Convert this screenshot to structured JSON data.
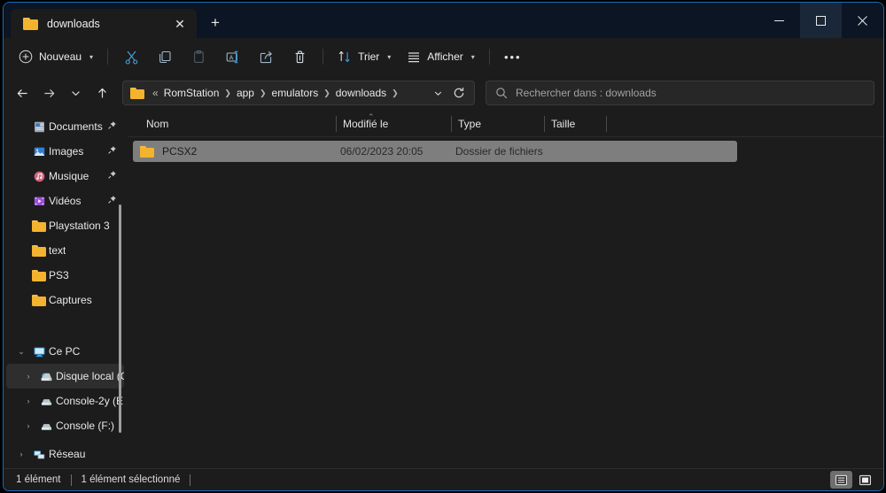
{
  "window": {
    "accent_border": "#1a6bb5",
    "titlebar_bg": "#0b1524",
    "chrome_bg": "#1c1c1c"
  },
  "titlebar": {
    "tab": {
      "icon": "folder-icon",
      "title": "downloads",
      "close_label": "✕"
    },
    "new_tab_label": "+",
    "controls": {
      "minimize": "minimize-icon",
      "maximize": "maximize-icon",
      "close": "close-icon"
    }
  },
  "toolbar": {
    "new_label": "Nouveau",
    "new_chevron": "▾",
    "cut_label": "cut-icon",
    "copy_label": "copy-icon",
    "paste_label": "paste-icon",
    "rename_label": "rename-icon",
    "share_label": "share-icon",
    "delete_label": "delete-icon",
    "sort_label": "Trier",
    "sort_chevron": "▾",
    "view_label": "Afficher",
    "view_chevron": "▾",
    "more_label": "•••"
  },
  "navbar": {
    "back_label": "←",
    "forward_label": "→",
    "recent_label": "▾",
    "up_label": "↑",
    "breadcrumb_prefix": "«",
    "breadcrumbs": [
      "RomStation",
      "app",
      "emulators",
      "downloads"
    ],
    "separator": "❯",
    "dropdown_chevron": "▾",
    "refresh_label": "↻"
  },
  "search": {
    "icon": "search-icon",
    "placeholder": "Rechercher dans : downloads",
    "value": ""
  },
  "sidebar": {
    "items": [
      {
        "label": "Documents",
        "icon": "documents-icon",
        "pinned": true,
        "twisty": "",
        "indent": 0,
        "selected": false
      },
      {
        "label": "Images",
        "icon": "pictures-icon",
        "pinned": true,
        "twisty": "",
        "indent": 0,
        "selected": false
      },
      {
        "label": "Musique",
        "icon": "music-icon",
        "pinned": true,
        "twisty": "",
        "indent": 0,
        "selected": false
      },
      {
        "label": "Vidéos",
        "icon": "videos-icon",
        "pinned": true,
        "twisty": "",
        "indent": 0,
        "selected": false
      },
      {
        "label": "Playstation 3",
        "icon": "folder-icon",
        "pinned": false,
        "twisty": "",
        "indent": 0,
        "selected": false
      },
      {
        "label": "text",
        "icon": "folder-icon",
        "pinned": false,
        "twisty": "",
        "indent": 0,
        "selected": false
      },
      {
        "label": "PS3",
        "icon": "folder-icon",
        "pinned": false,
        "twisty": "",
        "indent": 0,
        "selected": false
      },
      {
        "label": "Captures",
        "icon": "folder-icon",
        "pinned": false,
        "twisty": "",
        "indent": 0,
        "selected": false
      },
      {
        "label": "Ce PC",
        "icon": "this-pc-icon",
        "pinned": false,
        "twisty": "⌄",
        "indent": 0,
        "selected": false
      },
      {
        "label": "Disque local (C",
        "icon": "system-drive-icon",
        "pinned": false,
        "twisty": "›",
        "indent": 1,
        "selected": true
      },
      {
        "label": "Console-2y (E:",
        "icon": "drive-icon",
        "pinned": false,
        "twisty": "›",
        "indent": 1,
        "selected": false
      },
      {
        "label": "Console (F:)",
        "icon": "drive-icon",
        "pinned": false,
        "twisty": "›",
        "indent": 1,
        "selected": false
      },
      {
        "label": "Réseau",
        "icon": "network-icon",
        "pinned": false,
        "twisty": "›",
        "indent": 0,
        "selected": false
      }
    ],
    "pin_glyph": "📌"
  },
  "filelist": {
    "columns": [
      {
        "label": "Nom",
        "sorted": true
      },
      {
        "label": "Modifié le",
        "sorted": false
      },
      {
        "label": "Type",
        "sorted": false
      },
      {
        "label": "Taille",
        "sorted": false
      }
    ],
    "sort_arrow": "⌃",
    "rows": [
      {
        "icon": "folder-icon",
        "name": "PCSX2",
        "modified": "06/02/2023 20:05",
        "type": "Dossier de fichiers",
        "size": "",
        "selected": true
      }
    ]
  },
  "statusbar": {
    "item_count": "1 élément",
    "selection": "1 élément sélectionné",
    "views": [
      {
        "name": "details-view",
        "active": true
      },
      {
        "name": "large-icons-view",
        "active": false
      }
    ]
  }
}
